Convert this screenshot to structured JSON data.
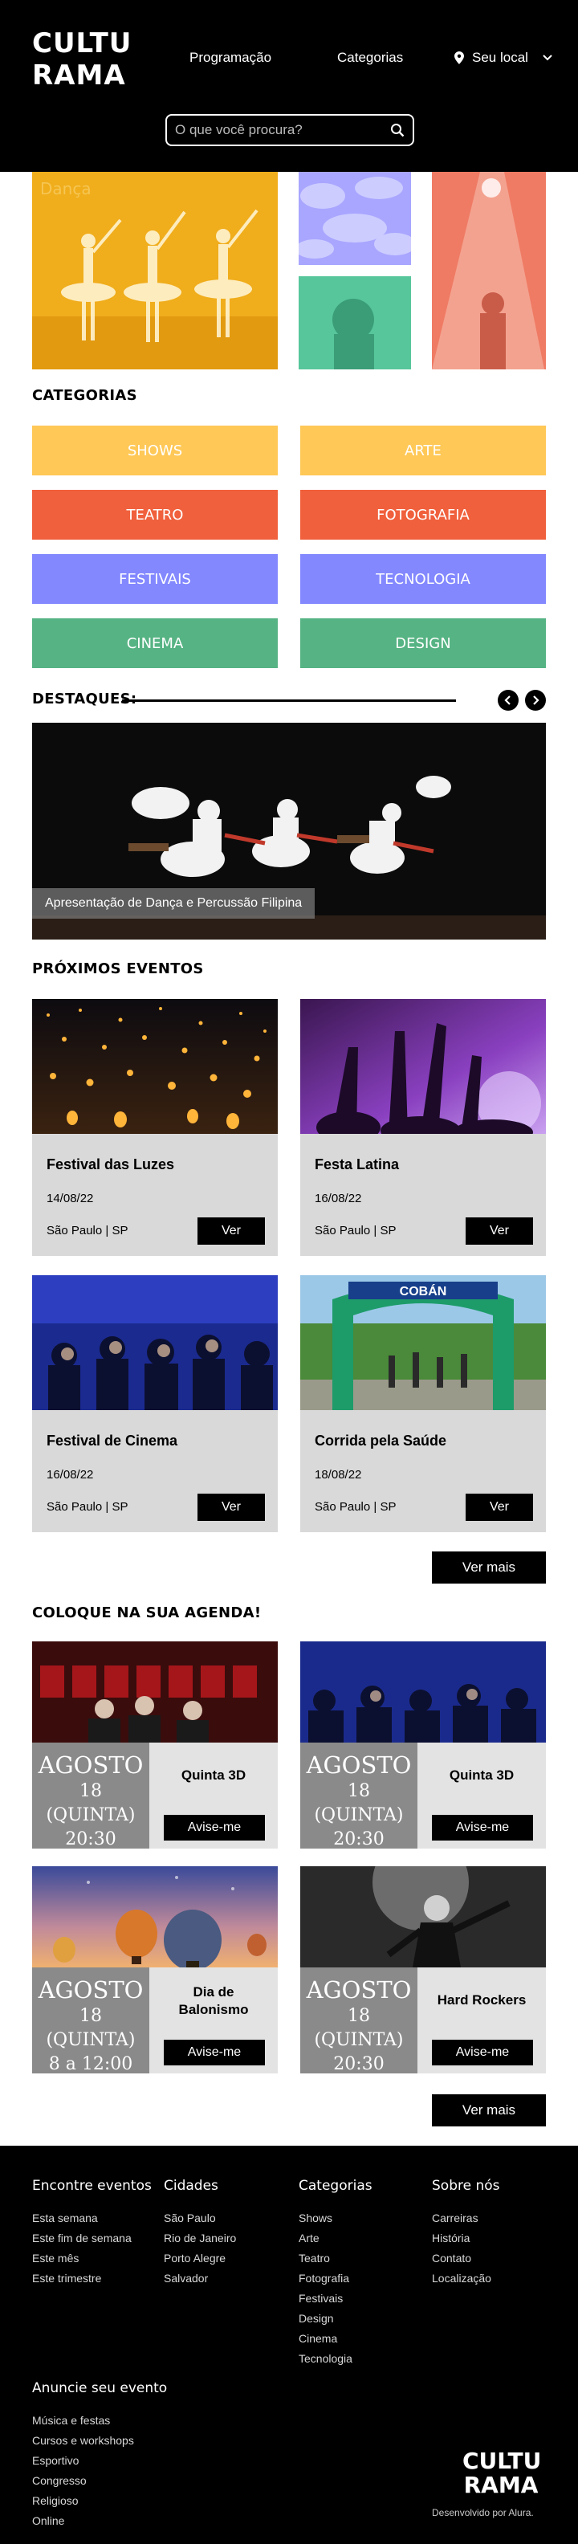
{
  "header": {
    "logo_line1": "CULTU",
    "logo_line2": "RAMA",
    "nav": [
      "Programação",
      "Categorias"
    ],
    "location_label": "Seu local",
    "search_placeholder": "O que você procura?"
  },
  "hero": {
    "overlay_text": "Dança"
  },
  "categories": {
    "title": "CATEGORIAS",
    "items": [
      {
        "label": "SHOWS",
        "color": "#FFC857"
      },
      {
        "label": "ARTE",
        "color": "#FFC857"
      },
      {
        "label": "TEATRO",
        "color": "#F0603C"
      },
      {
        "label": "FOTOGRAFIA",
        "color": "#F0603C"
      },
      {
        "label": "FESTIVAIS",
        "color": "#8388FF"
      },
      {
        "label": "TECNOLOGIA",
        "color": "#8388FF"
      },
      {
        "label": "CINEMA",
        "color": "#56B383"
      },
      {
        "label": "DESIGN",
        "color": "#56B383"
      }
    ]
  },
  "highlights": {
    "title": "DESTAQUES:",
    "caption": "Apresentação de Dança e Percussão Filipina"
  },
  "upcoming": {
    "title": "PRÓXIMOS EVENTOS",
    "events": [
      {
        "name": "Festival das Luzes",
        "date": "14/08/22",
        "city": "São Paulo | SP",
        "button": "Ver"
      },
      {
        "name": "Festa Latina",
        "date": "16/08/22",
        "city": "São Paulo | SP",
        "button": "Ver"
      },
      {
        "name": "Festival de Cinema",
        "date": "16/08/22",
        "city": "São Paulo | SP",
        "button": "Ver"
      },
      {
        "name": "Corrida pela Saúde",
        "date": "18/08/22",
        "city": "São Paulo | SP",
        "button": "Ver"
      }
    ],
    "more_label": "Ver mais",
    "banner_text": "COBÁN"
  },
  "agenda": {
    "title": "COLOQUE NA SUA AGENDA!",
    "items": [
      {
        "month": "AGOSTO",
        "day": "18 (QUINTA)",
        "time": "20:30",
        "title_line1": "Quinta 3D",
        "title_line2": "",
        "button": "Avise-me"
      },
      {
        "month": "AGOSTO",
        "day": "18 (QUINTA)",
        "time": "20:30",
        "title_line1": "Quinta 3D",
        "title_line2": "",
        "button": "Avise-me"
      },
      {
        "month": "AGOSTO",
        "day": "18 (QUINTA)",
        "time": "8 a 12:00",
        "title_line1": "Dia de",
        "title_line2": "Balonismo",
        "button": "Avise-me"
      },
      {
        "month": "AGOSTO",
        "day": "18 (QUINTA)",
        "time": "20:30",
        "title_line1": "Hard Rockers",
        "title_line2": "",
        "button": "Avise-me"
      }
    ],
    "more_label": "Ver mais"
  },
  "footer": {
    "columns": [
      {
        "title": "Encontre eventos",
        "links": [
          "Esta semana",
          "Este fim de semana",
          "Este mês",
          "Este trimestre"
        ]
      },
      {
        "title": "Cidades",
        "links": [
          "São Paulo",
          "Rio de Janeiro",
          "Porto Alegre",
          "Salvador"
        ]
      },
      {
        "title": "Categorias",
        "links": [
          "Shows",
          "Arte",
          "Teatro",
          "Fotografia",
          "Festivais",
          "Design",
          "Cinema",
          "Tecnologia"
        ]
      },
      {
        "title": "Sobre nós",
        "links": [
          "Carreiras",
          "História",
          "Contato",
          "Localização"
        ]
      },
      {
        "title": "Anuncie seu evento",
        "links": [
          "Música e festas",
          "Cursos e workshops",
          "Esportivo",
          "Congresso",
          "Religioso",
          "Online"
        ]
      }
    ],
    "logo_line1": "CULTU",
    "logo_line2": "RAMA",
    "credit": "Desenvolvido por Alura."
  }
}
